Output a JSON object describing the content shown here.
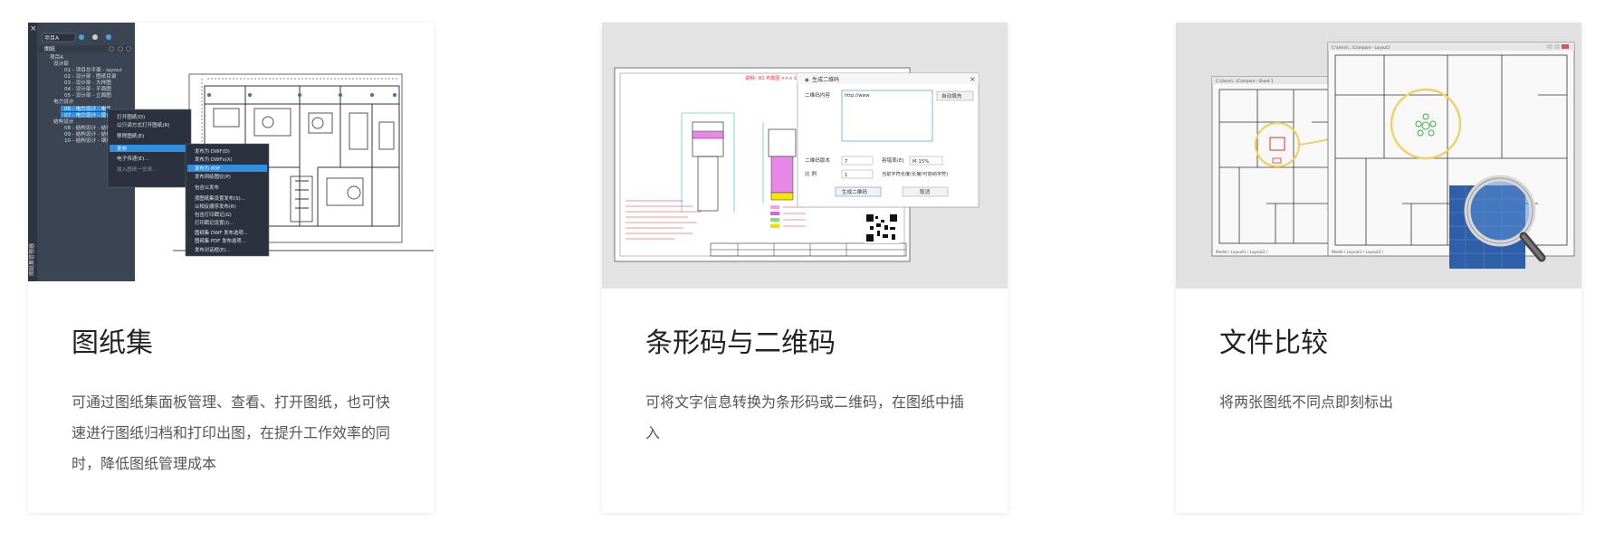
{
  "cards": [
    {
      "title": "图纸集",
      "description": "可通过图纸集面板管理、查看、打开图纸，也可快速进行图纸归档和打印出图，在提升工作效率的同时，降低图纸管理成本",
      "screenshot": {
        "panel_title": "图纸",
        "project_select": "项目A",
        "tree": [
          "项目A",
          "设计部",
          "01 - 项目总平面 - layout",
          "02 - 设计部 - 图纸目录",
          "03 - 设计部 - 大样图",
          "04 - 设计部 - 平面图",
          "05 - 设计部 - 立面图",
          "电力设计",
          "06 - 电力设计 - 电气",
          "07 - 电力设计 - 设备",
          "结构设计",
          "08 - 结构设计 - 结构",
          "09 - 结构设计 - 结构",
          "10 - 结构设计 - 钢筋"
        ],
        "context_menu": [
          "打开图纸(O)",
          "以只读方式打开图纸(R)",
          "移除图纸(E)",
          "发布",
          "电子传递(E)...",
          "插入图纸一览表..."
        ],
        "publish_submenu": [
          "发布为 DWF(D)",
          "发布为 DWFx(X)",
          "发布为 PDF",
          "发布到绘图仪(P)",
          "包含以发布",
          "按图纸集设置发布(S)...",
          "以相反顺序发布(R)",
          "包含打印戳记(G)",
          "打印戳记设置(I)...",
          "图纸集 DWF 发布选项...",
          "图纸集 PDF 发布选项...",
          "发布对话框(E)..."
        ],
        "side_label": "图纸集管理器"
      }
    },
    {
      "title": "条形码与二维码",
      "description": "可将文字信息转换为条形码或二维码，在图纸中插入",
      "screenshot": {
        "dialog_title": "生成二维码",
        "content_label": "二维码内容",
        "content_value": "http://www",
        "auto_button": "自动填充",
        "version_label": "二维码版本",
        "version_value": "7",
        "ecc_label": "容错率(E)",
        "ecc_value": "M 15%",
        "scale_label": "比 例",
        "scale_value": "1",
        "keep_label": "当前字符长度(长度/可容纳字符)",
        "generate_button": "生成二维码",
        "cancel_button": "取消",
        "drawing_header": "说明：R1 布置图  ×××  1:100"
      }
    },
    {
      "title": "文件比较",
      "description": "将两张图纸不同点即刻标出",
      "screenshot": {
        "window_title_left": "C:\\Users\\...\\Compare - Sheet 1",
        "window_title_right": "C:\\Users\\...\\Compare - Layout1",
        "tab_left": "Model / Layout1 / Layout2 /",
        "tab_right": "Model / Layout1 / Layout2 /"
      }
    }
  ]
}
